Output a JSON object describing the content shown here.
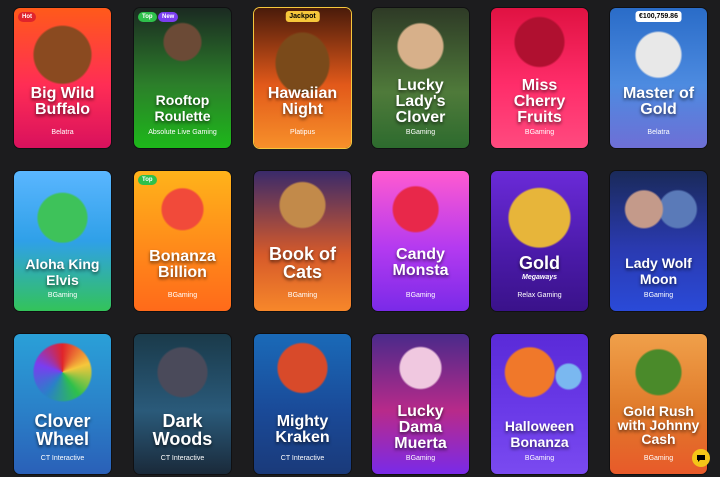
{
  "games": [
    {
      "title": "Big Wild Buffalo",
      "provider": "Belatra",
      "badge": "Hot",
      "badge_type": "hot"
    },
    {
      "title": "Rooftop Roulette",
      "provider": "Absolute Live Gaming",
      "badges": [
        "Top",
        "New"
      ]
    },
    {
      "title": "Hawaiian Night",
      "provider": "Platipus",
      "badge": "Jackpot",
      "badge_type": "jackpot"
    },
    {
      "title": "Lucky Lady's Clover",
      "provider": "BGaming"
    },
    {
      "title": "Miss Cherry Fruits",
      "provider": "BGaming"
    },
    {
      "title": "Master of Gold",
      "provider": "Belatra",
      "badge": "€100,759.86",
      "badge_type": "amount"
    },
    {
      "title": "Aloha King Elvis",
      "provider": "BGaming"
    },
    {
      "title": "Bonanza Billion",
      "provider": "BGaming",
      "badge": "Top",
      "badge_type": "top"
    },
    {
      "title": "Book of Cats",
      "provider": "BGaming"
    },
    {
      "title": "Candy Monsta",
      "provider": "BGaming"
    },
    {
      "title": "Gold",
      "subtitle": "Megaways",
      "provider": "Relax Gaming"
    },
    {
      "title": "Lady Wolf Moon",
      "provider": "BGaming"
    },
    {
      "title": "Clover Wheel",
      "provider": "CT Interactive"
    },
    {
      "title": "Dark Woods",
      "provider": "CT Interactive"
    },
    {
      "title": "Mighty Kraken",
      "provider": "CT Interactive"
    },
    {
      "title": "Lucky Dama Muerta",
      "provider": "BGaming"
    },
    {
      "title": "Halloween Bonanza",
      "provider": "BGaming"
    },
    {
      "title": "Gold Rush with Johnny Cash",
      "provider": "BGaming"
    }
  ],
  "colors": {
    "background": "#1c1c1e",
    "hot": "#e0242b",
    "top": "#2ec04b",
    "new": "#7a3df0",
    "jackpot": "#f6c73b",
    "chat": "#f5c518"
  },
  "icons": {
    "chat": "chat-bubble-icon"
  }
}
